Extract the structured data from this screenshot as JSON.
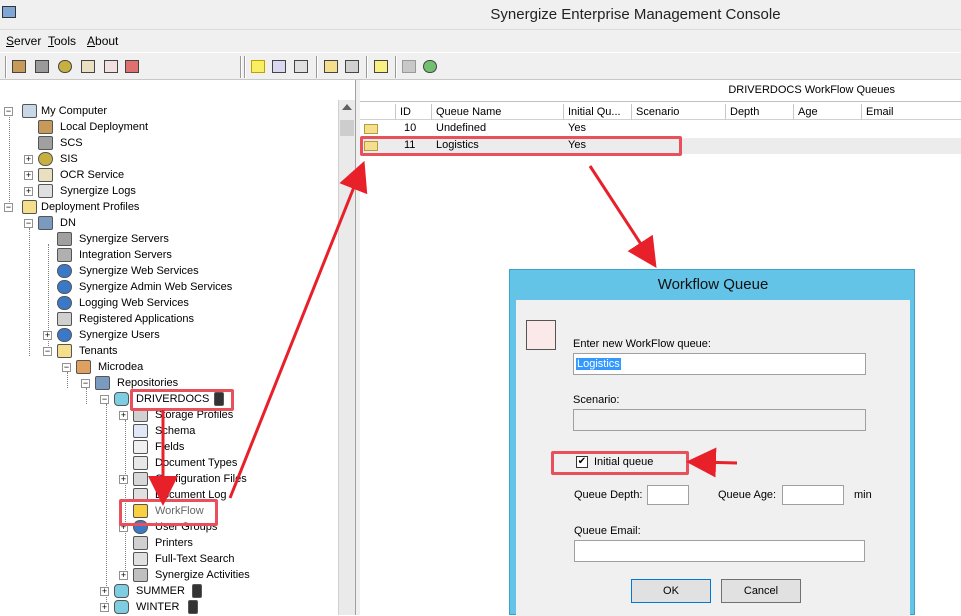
{
  "app": {
    "title": "Synergize Enterprise Management Console"
  },
  "menu": {
    "items": [
      {
        "label": "Server",
        "u": "S"
      },
      {
        "label": "Tools",
        "u": "T"
      },
      {
        "label": "About",
        "u": "A"
      }
    ]
  },
  "toolbar": {
    "icons": [
      "deploy-icon",
      "network-icon",
      "sis-icon",
      "book-icon",
      "edit-icon",
      "export-icon",
      "new-icon",
      "properties-icon",
      "settings-icon",
      "open-folder-icon",
      "move-down-icon",
      "notes-icon",
      "grid-icon",
      "refresh-icon"
    ]
  },
  "tree": {
    "my_computer": "My Computer",
    "local_deployment": "Local Deployment",
    "scs": "SCS",
    "sis": "SIS",
    "ocr_service": "OCR Service",
    "synergize_logs": "Synergize Logs",
    "deployment_profiles": "Deployment Profiles",
    "dn": "DN",
    "synergize_servers": "Synergize Servers",
    "integration_servers": "Integration Servers",
    "synergize_web_services": "Synergize Web Services",
    "synergize_admin_web_services": "Synergize Admin Web Services",
    "logging_web_services": "Logging Web Services",
    "registered_applications": "Registered Applications",
    "synergize_users": "Synergize Users",
    "tenants": "Tenants",
    "microdea": "Microdea",
    "repositories": "Repositories",
    "driverdocs": "DRIVERDOCS",
    "storage_profiles": "Storage Profiles",
    "schema": "Schema",
    "fields": "Fields",
    "document_types": "Document Types",
    "configuration_files": "Configuration Files",
    "document_log": "Document Log",
    "workflow": "WorkFlow",
    "user_groups": "User Groups",
    "printers": "Printers",
    "full_text_search": "Full-Text Search",
    "synergize_activities": "Synergize Activities",
    "summer": "SUMMER",
    "winter": "WINTER"
  },
  "queues": {
    "header": "DRIVERDOCS WorkFlow Queues",
    "columns": [
      "ID",
      "Queue Name",
      "Initial Qu...",
      "Scenario",
      "Depth",
      "Age",
      "Email"
    ],
    "rows": [
      {
        "id": "10",
        "name": "Undefined",
        "initial": "Yes"
      },
      {
        "id": "11",
        "name": "Logistics",
        "initial": "Yes"
      }
    ]
  },
  "dialog": {
    "title": "Workflow Queue",
    "enter_label": "Enter new WorkFlow queue:",
    "queue_value": "Logistics",
    "scenario_label": "Scenario:",
    "scenario_value": "",
    "initial_queue_label": "Initial queue",
    "initial_queue_checked": true,
    "depth_label": "Queue Depth:",
    "depth_value": "",
    "age_label": "Queue Age:",
    "age_value": "",
    "age_unit": "min",
    "email_label": "Queue Email:",
    "email_value": "",
    "ok_label": "OK",
    "cancel_label": "Cancel"
  },
  "colors": {
    "highlight": "#e8505b",
    "arrow": "#e8202a",
    "dialog_title": "#63c4e8",
    "selection": "#3399ff"
  }
}
